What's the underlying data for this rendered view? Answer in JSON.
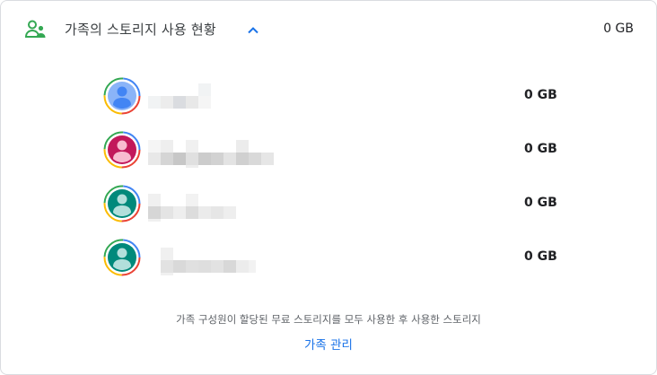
{
  "header": {
    "title": "가족의 스토리지 사용 현황",
    "total_usage": "0 GB",
    "icon": "family-icon",
    "toggle_icon": "chevron-up-icon"
  },
  "members": [
    {
      "name": "",
      "usage": "0 GB",
      "avatar_color": "#8ab4f8",
      "avatar_figure": "#4285f4"
    },
    {
      "name": "",
      "usage": "0 GB",
      "avatar_color": "#c2185b",
      "avatar_figure": "#f8bbd0"
    },
    {
      "name": "",
      "usage": "0 GB",
      "avatar_color": "#00897b",
      "avatar_figure": "#b2dfdb"
    },
    {
      "name": "",
      "usage": "0 GB",
      "avatar_color": "#00897b",
      "avatar_figure": "#b2dfdb"
    }
  ],
  "footnote": "가족 구성원이 할당된 무료 스토리지를 모두 사용한 후 사용한 스토리지",
  "manage_link": "가족 관리",
  "colors": {
    "accent": "#1a73e8",
    "family_icon": "#34a853"
  }
}
